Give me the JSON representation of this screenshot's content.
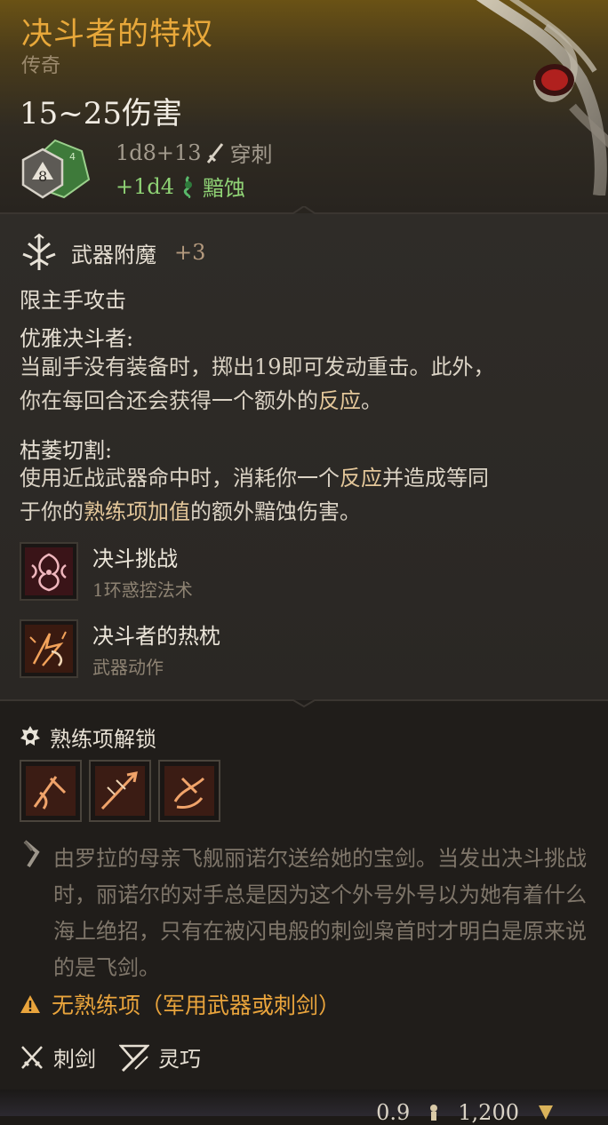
{
  "item": {
    "title": "决斗者的特权",
    "rarity": "传奇",
    "damage": "15~25伤害",
    "dice_badge": "8",
    "dice_badge_small": "4",
    "damage_rows": [
      {
        "dice": "1d8+13",
        "type": "穿刺",
        "icon": "piercing-icon"
      },
      {
        "dice": "+1d4",
        "type": "黯蚀",
        "icon": "necrotic-icon"
      }
    ]
  },
  "enchant": {
    "icon": "weapon-enchant-icon",
    "label": "武器附魔",
    "bonus": "+3"
  },
  "props": {
    "main_hand": "限主手攻击",
    "elegant_title": "优雅决斗者:",
    "elegant_line1": "当副手没有装备时，掷出19即可发动重击。此外，",
    "elegant_line2a": "你在每回合还会获得一个额外的",
    "elegant_line2b": "反应",
    "elegant_line2c": "。",
    "wither_title": "枯萎切割:",
    "wither_line1a": "使用近战武器命中时，消耗你一个",
    "wither_line1b": "反应",
    "wither_line1c": "并造成等同",
    "wither_line2a": "于你的",
    "wither_line2b": "熟练项加值",
    "wither_line2c": "的额外黯蚀伤害。"
  },
  "spells": [
    {
      "name": "决斗挑战",
      "sub": "1环惑控法术",
      "icon": "duel-challenge-icon"
    },
    {
      "name": "决斗者的热枕",
      "sub": "武器动作",
      "icon": "duelist-zeal-icon"
    }
  ],
  "proficiency": {
    "label": "熟练项解锁",
    "icon": "proficiency-icon",
    "actions": [
      "lacerate-icon",
      "piercing-strike-icon",
      "flourish-icon"
    ]
  },
  "flavor": {
    "text": "由罗拉的母亲飞舰丽诺尔送给她的宝剑。当发出决斗挑战时，丽诺尔的对手总是因为这个外号外号以为她有着什么海上绝招，只有在被闪电般的刺剑枭首时才明白是原来说的是飞剑。"
  },
  "warning": {
    "text": "无熟练项（军用武器或刺剑）",
    "color": "#e9a43c"
  },
  "tags": [
    {
      "label": "刺剑",
      "icon": "rapier-icon"
    },
    {
      "label": "灵巧",
      "icon": "finesse-icon"
    }
  ],
  "footer": {
    "weight": "0.9",
    "value": "1,200"
  }
}
